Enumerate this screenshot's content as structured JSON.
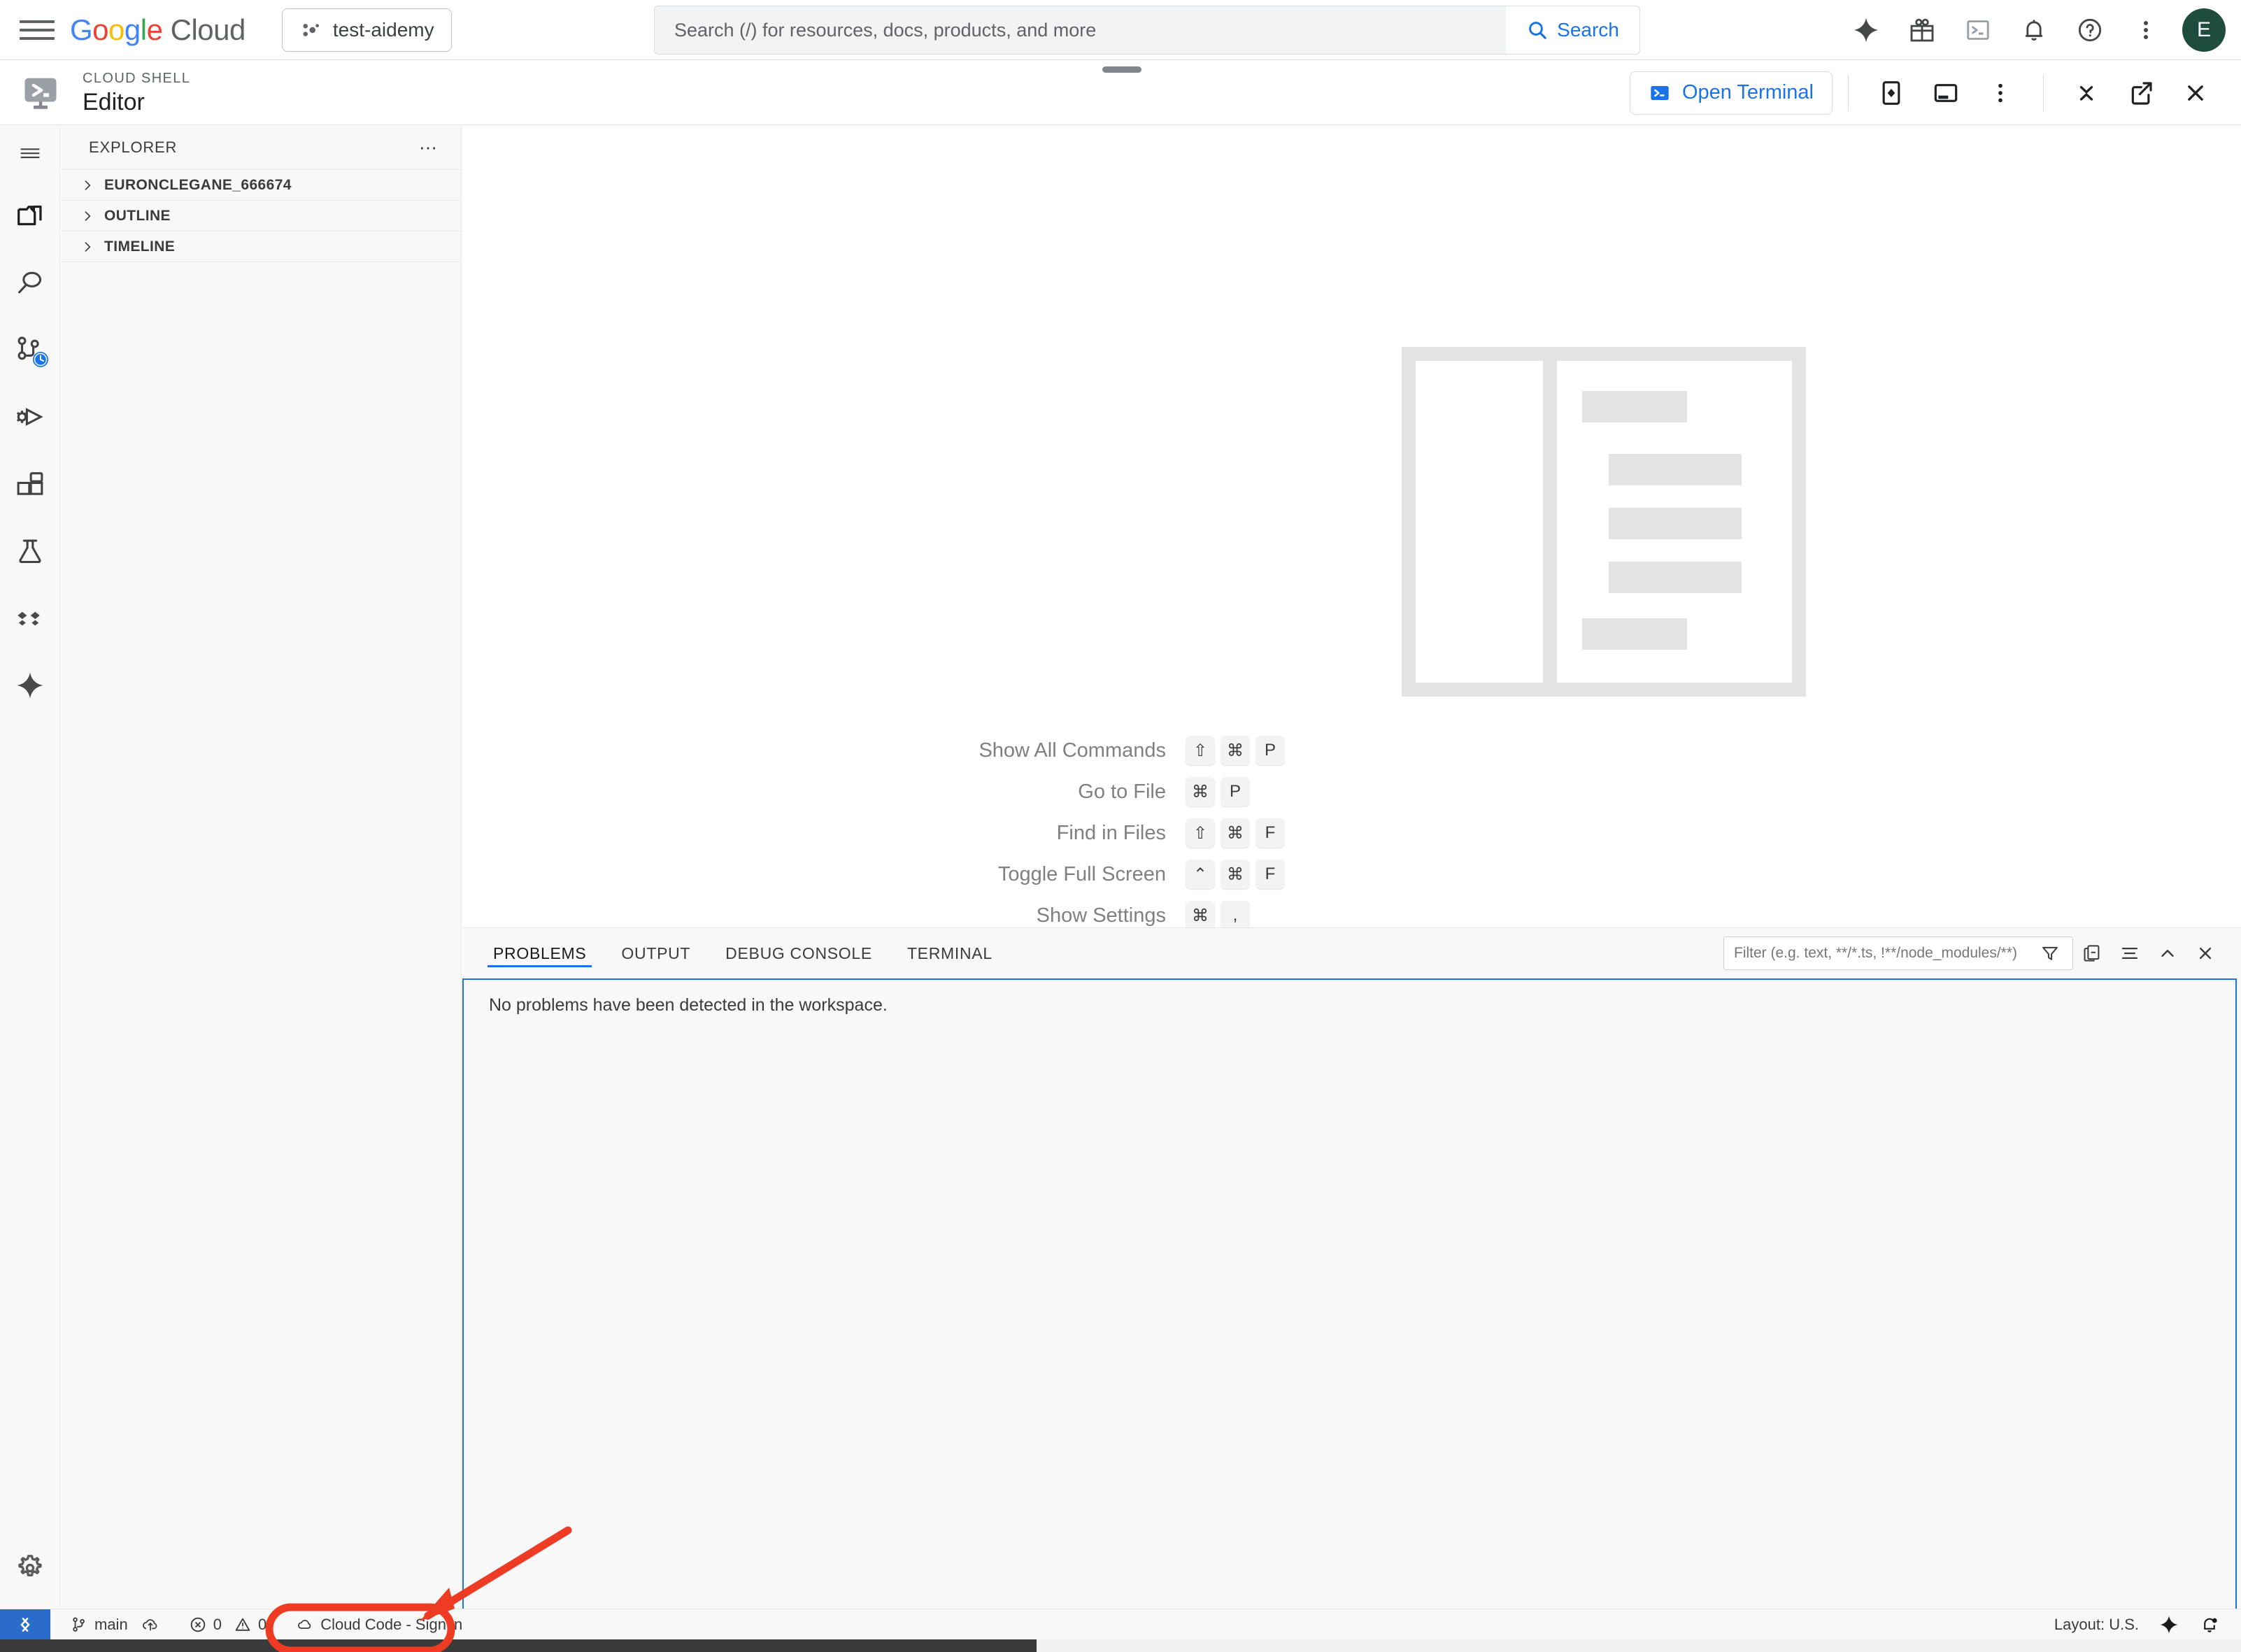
{
  "topbar": {
    "menu_icon": "hamburger-icon",
    "logo_google": "Google",
    "logo_cloud": "Cloud",
    "project": "test-aidemy",
    "search_placeholder": "Search (/) for resources, docs, products, and more",
    "search_value": "",
    "search_button": "Search",
    "icons": [
      "gemini-sparkle-icon",
      "gift-icon",
      "cloud-shell-icon",
      "notifications-bell-icon",
      "help-question-icon",
      "more-vert-icon"
    ],
    "avatar_initial": "E"
  },
  "cloudshell": {
    "kicker": "CLOUD SHELL",
    "title": "Editor",
    "open_terminal": "Open Terminal",
    "actions": [
      "cloud-code-icon",
      "restore-panel-icon",
      "more-vert-icon",
      "minimize-icon",
      "open-new-window-icon",
      "close-icon"
    ]
  },
  "activitybar": {
    "items": [
      {
        "name": "menu-icon"
      },
      {
        "name": "explorer-files-icon"
      },
      {
        "name": "search-icon"
      },
      {
        "name": "source-control-icon"
      },
      {
        "name": "run-and-debug-icon"
      },
      {
        "name": "extensions-icon"
      },
      {
        "name": "testing-flask-icon"
      },
      {
        "name": "cloud-code-diamonds-icon"
      },
      {
        "name": "gemini-sparkle-icon"
      }
    ],
    "settings": "manage-gear-icon"
  },
  "sidebar": {
    "title": "EXPLORER",
    "more_actions": "views-and-more-actions-icon",
    "sections": [
      {
        "label": "EURONCLEGANE_666674",
        "expanded": false
      },
      {
        "label": "OUTLINE",
        "expanded": false
      },
      {
        "label": "TIMELINE",
        "expanded": false
      }
    ]
  },
  "welcome": {
    "shortcuts": [
      {
        "label": "Show All Commands",
        "keys": [
          "⇧",
          "⌘",
          "P"
        ]
      },
      {
        "label": "Go to File",
        "keys": [
          "⌘",
          "P"
        ]
      },
      {
        "label": "Find in Files",
        "keys": [
          "⇧",
          "⌘",
          "F"
        ]
      },
      {
        "label": "Toggle Full Screen",
        "keys": [
          "⌃",
          "⌘",
          "F"
        ]
      },
      {
        "label": "Show Settings",
        "keys": [
          "⌘",
          ","
        ]
      }
    ]
  },
  "panel": {
    "tabs": [
      {
        "label": "PROBLEMS",
        "active": true
      },
      {
        "label": "OUTPUT",
        "active": false
      },
      {
        "label": "DEBUG CONSOLE",
        "active": false
      },
      {
        "label": "TERMINAL",
        "active": false
      }
    ],
    "filter_placeholder": "Filter (e.g. text, **/*.ts, !**/node_modules/**)",
    "filter_value": "",
    "actions": [
      "filter-funnel-icon",
      "collapse-all-icon",
      "view-as-list-icon",
      "maximize-panel-icon",
      "close-panel-icon"
    ],
    "message": "No problems have been detected in the workspace."
  },
  "statusbar": {
    "remote_icon": "remote-window-icon",
    "branch": "main",
    "sync_icon": "sync-cloud-icon",
    "errors": "0",
    "warnings": "0",
    "cloud_code": "Cloud Code - Sign in",
    "layout": "Layout: U.S.",
    "gemini_icon": "gemini-sparkle-icon",
    "bell_icon": "notifications-bell-dot-icon"
  },
  "annotation": {
    "color": "#EE3B24",
    "target": "Cloud Code - Sign in"
  }
}
